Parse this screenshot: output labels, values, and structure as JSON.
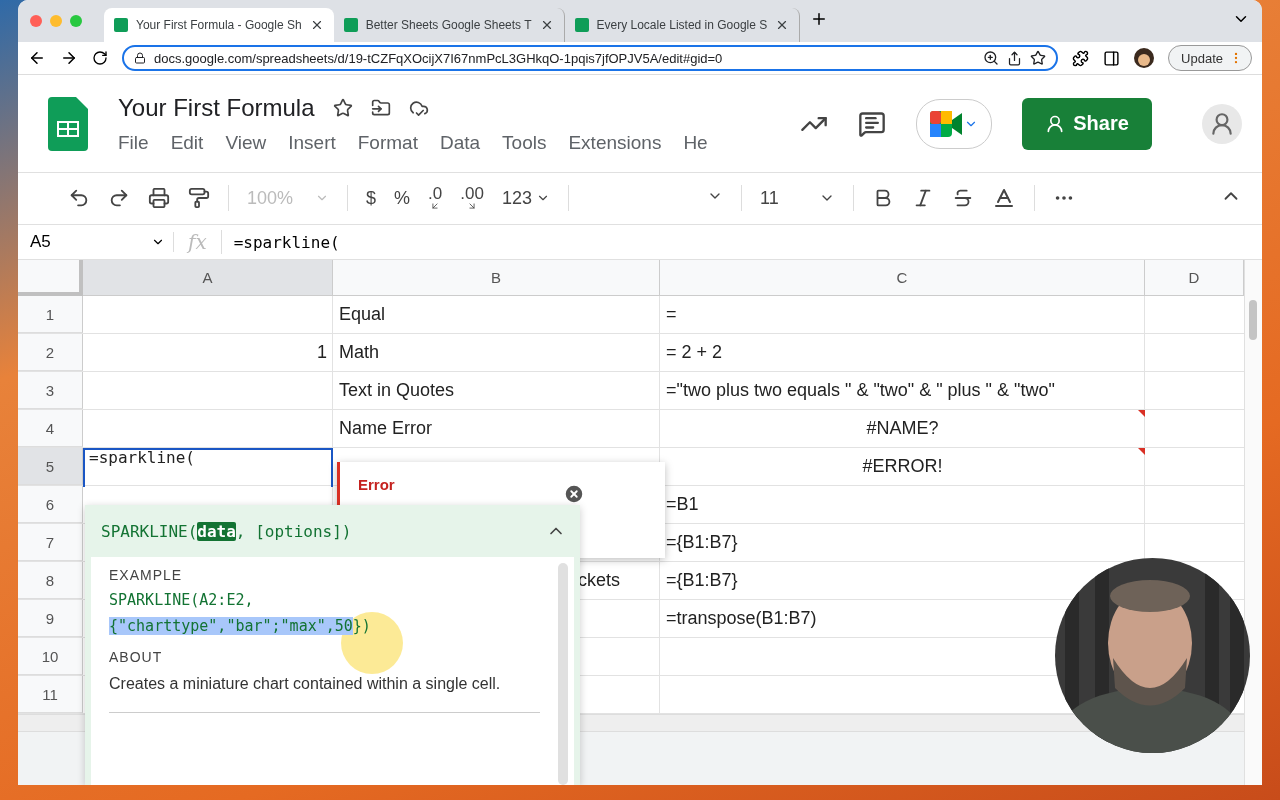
{
  "browser": {
    "tabs": [
      {
        "title": "Your First Formula - Google Sh",
        "selected": true
      },
      {
        "title": "Better Sheets Google Sheets T",
        "selected": false
      },
      {
        "title": "Every Locale Listed in Google S",
        "selected": false
      }
    ],
    "address": "docs.google.com/spreadsheets/d/19-tCZFqXOcijX7I67nmPcL3GHkqO-1pqis7jfOPJV5A/edit#gid=0",
    "update_label": "Update"
  },
  "doc": {
    "title": "Your First Formula",
    "menu": [
      "File",
      "Edit",
      "View",
      "Insert",
      "Format",
      "Data",
      "Tools",
      "Extensions",
      "He"
    ],
    "share_label": "Share"
  },
  "toolbar": {
    "zoom": "100%",
    "currency": "$",
    "percent": "%",
    "decrease_decimals": ".0",
    "increase_decimals": ".00",
    "number_format": "123",
    "font_size": "11"
  },
  "formula_bar": {
    "cell_ref": "A5",
    "fx": "fx",
    "formula": "=sparkline("
  },
  "grid": {
    "columns": [
      {
        "label": "A",
        "selected": true
      },
      {
        "label": "B",
        "selected": false
      },
      {
        "label": "C",
        "selected": false
      },
      {
        "label": "D",
        "selected": false
      }
    ],
    "rows": [
      {
        "number": "1",
        "selected": false,
        "cells": [
          null,
          {
            "kind": "text",
            "text": "Equal"
          },
          {
            "kind": "text",
            "text": "="
          },
          null
        ]
      },
      {
        "number": "2",
        "selected": false,
        "cells": [
          {
            "kind": "number",
            "text": "1"
          },
          {
            "kind": "text",
            "text": "Math"
          },
          {
            "kind": "text",
            "text": "= 2 + 2"
          },
          null
        ]
      },
      {
        "number": "3",
        "selected": false,
        "cells": [
          null,
          {
            "kind": "text",
            "text": "Text in Quotes"
          },
          {
            "kind": "text",
            "text": "=\"two plus two equals \" & \"two\" & \" plus \" & \"two\""
          },
          null
        ]
      },
      {
        "number": "4",
        "selected": false,
        "cells": [
          null,
          {
            "kind": "text",
            "text": "Name Error"
          },
          {
            "kind": "error",
            "text": "#NAME?"
          },
          null
        ]
      },
      {
        "number": "5",
        "selected": true,
        "cells": [
          {
            "kind": "editing",
            "text": "=sparkline("
          },
          null,
          {
            "kind": "error",
            "text": "#ERROR!"
          },
          null
        ]
      },
      {
        "number": "6",
        "selected": false,
        "cells": [
          null,
          null,
          {
            "kind": "text",
            "text": "=B1"
          },
          null
        ]
      },
      {
        "number": "7",
        "selected": false,
        "cells": [
          null,
          null,
          {
            "kind": "text",
            "text": "={B1:B7}"
          },
          null
        ]
      },
      {
        "number": "8",
        "selected": false,
        "cells": [
          null,
          {
            "kind": "clipped",
            "text": "ckets"
          },
          {
            "kind": "text",
            "text": "={B1:B7}"
          },
          null
        ]
      },
      {
        "number": "9",
        "selected": false,
        "cells": [
          null,
          null,
          {
            "kind": "text",
            "text": "=transpose(B1:B7)"
          },
          null
        ]
      },
      {
        "number": "10",
        "selected": false,
        "cells": [
          null,
          null,
          null,
          null
        ]
      },
      {
        "number": "11",
        "selected": false,
        "cells": [
          null,
          null,
          null,
          null
        ]
      }
    ]
  },
  "error_popup": {
    "title": "Error"
  },
  "function_help": {
    "signature": [
      {
        "text": "SPARKLINE(",
        "selected": false
      },
      {
        "text": "data",
        "selected": true
      },
      {
        "text": ", [options])",
        "selected": false
      }
    ],
    "example_heading": "EXAMPLE",
    "example_lines": [
      [
        {
          "text": "SPARKLINE(A2:E2,",
          "selected": false
        }
      ],
      [
        {
          "text": "{\"charttype\",\"bar\";\"max\",50",
          "selected": true
        },
        {
          "text": "})",
          "selected": false
        }
      ]
    ],
    "about_heading": "ABOUT",
    "about": "Creates a miniature chart contained within a single cell."
  }
}
